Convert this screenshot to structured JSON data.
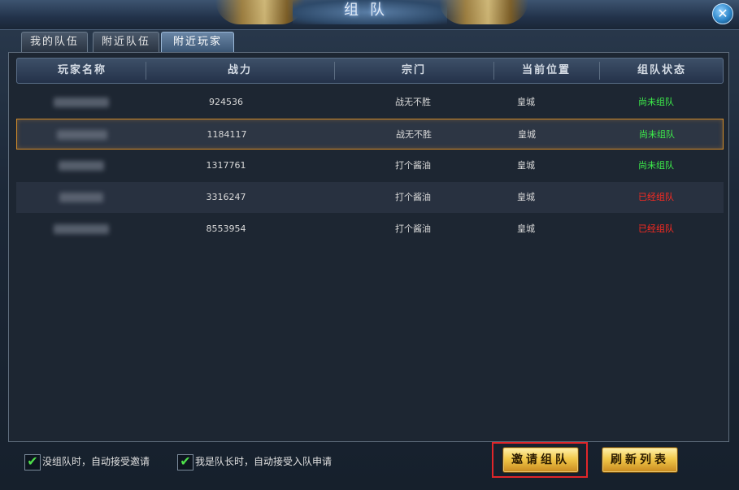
{
  "window": {
    "title": "组队",
    "close_icon": "close-icon"
  },
  "tabs": [
    {
      "label": "我的队伍",
      "active": false
    },
    {
      "label": "附近队伍",
      "active": false
    },
    {
      "label": "附近玩家",
      "active": true
    }
  ],
  "table": {
    "columns": [
      "玩家名称",
      "战力",
      "宗门",
      "当前位置",
      "组队状态"
    ],
    "rows": [
      {
        "name": "",
        "power": "924536",
        "sect": "战无不胜",
        "location": "皇城",
        "status": "尚未组队",
        "status_color": "#3df04a",
        "selected": false
      },
      {
        "name": "",
        "power": "1184117",
        "sect": "战无不胜",
        "location": "皇城",
        "status": "尚未组队",
        "status_color": "#3df04a",
        "selected": true
      },
      {
        "name": "",
        "power": "1317761",
        "sect": "打个酱油",
        "location": "皇城",
        "status": "尚未组队",
        "status_color": "#3df04a",
        "selected": false
      },
      {
        "name": "",
        "power": "3316247",
        "sect": "打个酱油",
        "location": "皇城",
        "status": "已经组队",
        "status_color": "#ff2a20",
        "selected": false
      },
      {
        "name": "",
        "power": "8553954",
        "sect": "打个酱油",
        "location": "皇城",
        "status": "已经组队",
        "status_color": "#ff2a20",
        "selected": false
      }
    ]
  },
  "options": [
    {
      "label": "没组队时，自动接受邀请",
      "checked": true
    },
    {
      "label": "我是队长时，自动接受入队申请",
      "checked": true
    }
  ],
  "buttons": {
    "invite": "邀请组队",
    "refresh": "刷新列表"
  },
  "colors": {
    "accent_gold": "#f2c94a",
    "selection_border": "#d08a2a",
    "status_free": "#3df04a",
    "status_teamed": "#ff2a20"
  }
}
